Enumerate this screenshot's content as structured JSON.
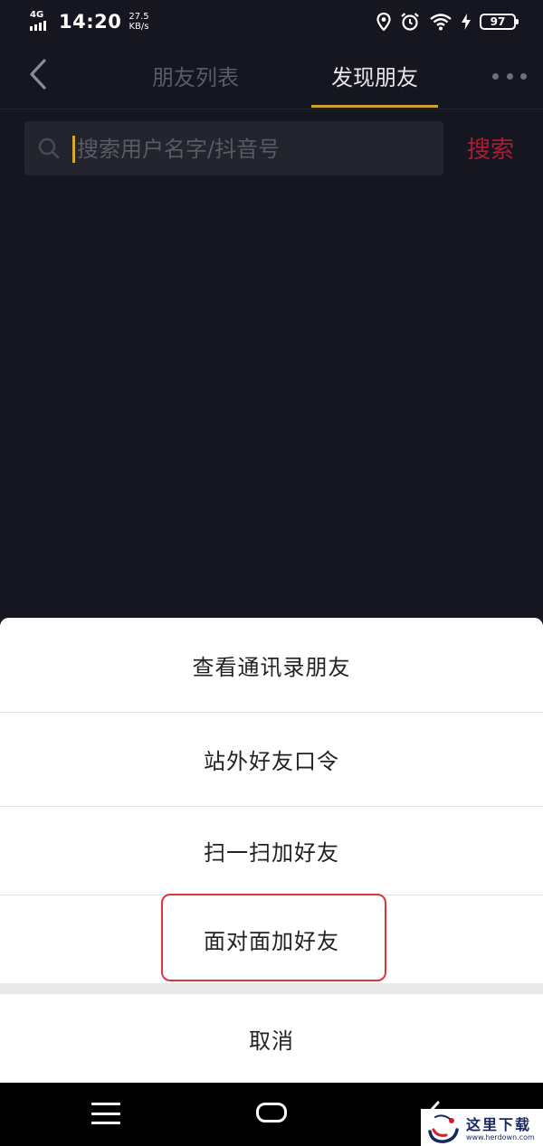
{
  "status_bar": {
    "network": "4G",
    "time": "14:20",
    "speed_value": "27.5",
    "speed_unit": "KB/s",
    "battery": "97",
    "icons": [
      "signal-icon",
      "location-icon",
      "alarm-icon",
      "wifi-icon",
      "charging-icon",
      "battery-icon"
    ]
  },
  "header": {
    "tabs": [
      {
        "label": "朋友列表",
        "active": false
      },
      {
        "label": "发现朋友",
        "active": true
      }
    ],
    "accent_color": "#c9a231"
  },
  "search": {
    "placeholder": "搜索用户名字/抖音号",
    "value": "",
    "button_label": "搜索",
    "button_color": "#a81f35"
  },
  "sheet": {
    "items": [
      {
        "label": "查看通讯录朋友"
      },
      {
        "label": "站外好友口令"
      },
      {
        "label": "扫一扫加好友"
      },
      {
        "label": "面对面加好友",
        "highlighted": true
      }
    ],
    "cancel_label": "取消",
    "highlight_color": "#e0343c"
  },
  "nav_bar": {
    "icons": [
      "menu-icon",
      "home-icon",
      "back-icon"
    ]
  },
  "watermark": {
    "text": "这里下载",
    "url": "www.herdown.com"
  }
}
